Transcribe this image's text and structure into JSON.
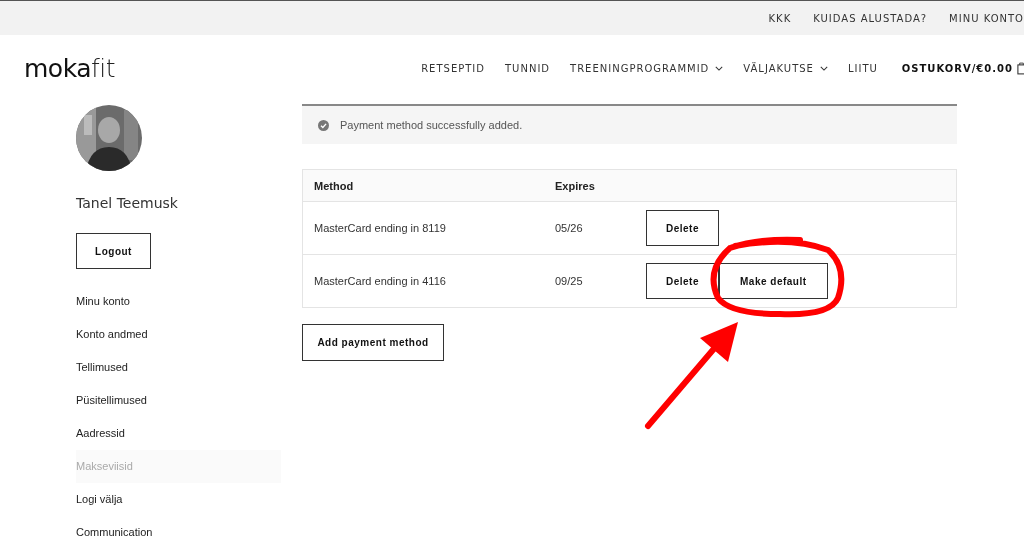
{
  "top_bar": {
    "links": [
      "KKK",
      "KUIDAS ALUSTADA?",
      "MINU KONTO"
    ]
  },
  "header": {
    "logo_main": "moka",
    "logo_accent": "fit",
    "nav": [
      {
        "label": "RETSEPTID",
        "dropdown": false
      },
      {
        "label": "TUNNID",
        "dropdown": false
      },
      {
        "label": "TREENINGPROGRAMMID",
        "dropdown": true
      },
      {
        "label": "VÄLJAKUTSE",
        "dropdown": true
      },
      {
        "label": "LIITU",
        "dropdown": false
      }
    ],
    "cart": "OSTUKORV/€0.00"
  },
  "sidebar": {
    "user_name": "Tanel Teemusk",
    "logout": "Logout",
    "items": [
      {
        "label": "Minu konto",
        "selected": false
      },
      {
        "label": "Konto andmed",
        "selected": false
      },
      {
        "label": "Tellimused",
        "selected": false
      },
      {
        "label": "Püsitellimused",
        "selected": false
      },
      {
        "label": "Aadressid",
        "selected": false
      },
      {
        "label": "Makseviisid",
        "selected": true
      },
      {
        "label": "Logi välja",
        "selected": false
      },
      {
        "label": "Communication",
        "selected": false
      }
    ]
  },
  "notice": {
    "message": "Payment method successfully added."
  },
  "table": {
    "columns": [
      "Method",
      "Expires"
    ],
    "rows": [
      {
        "method": "MasterCard ending in 8119",
        "expires": "05/26",
        "actions": [
          "Delete"
        ]
      },
      {
        "method": "MasterCard ending in 4116",
        "expires": "09/25",
        "actions": [
          "Delete",
          "Make default"
        ]
      }
    ]
  },
  "add_button": "Add payment method"
}
